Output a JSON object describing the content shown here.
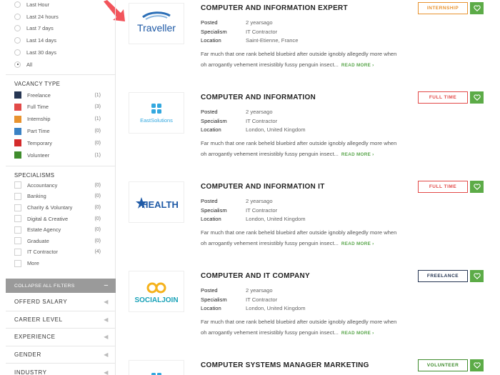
{
  "sidebar": {
    "posted": [
      {
        "label": "Last Hour",
        "checked": false
      },
      {
        "label": "Last 24 hours",
        "checked": false
      },
      {
        "label": "Last 7 days",
        "checked": false
      },
      {
        "label": "Last 14 days",
        "checked": false
      },
      {
        "label": "Last 30 days",
        "checked": false
      },
      {
        "label": "All",
        "checked": true
      }
    ],
    "vacancy_title": "VACANCY TYPE",
    "vacancy": [
      {
        "label": "Freelance",
        "count": "(1)",
        "color": "#263653"
      },
      {
        "label": "Full Time",
        "count": "(3)",
        "color": "#e24a48"
      },
      {
        "label": "Internship",
        "count": "(1)",
        "color": "#e8932f"
      },
      {
        "label": "Part Time",
        "count": "(0)",
        "color": "#3a82c4"
      },
      {
        "label": "Temporary",
        "count": "(0)",
        "color": "#d42b2b"
      },
      {
        "label": "Volunteer",
        "count": "(1)",
        "color": "#3f8c2d"
      }
    ],
    "specialisms_title": "SPECIALISMS",
    "specialisms": [
      {
        "label": "Accountancy",
        "count": "(0)"
      },
      {
        "label": "Banking",
        "count": "(0)"
      },
      {
        "label": "Charity & Voluntary",
        "count": "(0)"
      },
      {
        "label": "Digital & Creative",
        "count": "(0)"
      },
      {
        "label": "Estate Agency",
        "count": "(0)"
      },
      {
        "label": "Graduate",
        "count": "(0)"
      },
      {
        "label": "IT Contractor",
        "count": "(4)"
      }
    ],
    "more_label": "More",
    "collapse_label": "COLLAPSE ALL FILTERS",
    "collapse_icon": "−",
    "accordions": [
      "OFFERD SALARY",
      "CAREER LEVEL",
      "EXPERIENCE",
      "GENDER",
      "INDUSTRY"
    ]
  },
  "labels": {
    "posted": "Posted",
    "specialism": "Specialism",
    "location": "Location",
    "read_more": "READ MORE",
    "read_more_chevron": "›"
  },
  "jobs": [
    {
      "title": "COMPUTER AND INFORMATION EXPERT",
      "posted": "2 yearsago",
      "specialism": "IT Contractor",
      "location": "Saint-Etienne, France",
      "desc1": "Far much that one rank beheld bluebird after outside ignobly allegedly more when",
      "desc2": "oh arrogantly vehement irresistibly fussy penguin insect...",
      "type": "INTERNSHIP",
      "type_color": "#e8932f",
      "logo": "Traveller"
    },
    {
      "title": "COMPUTER AND INFORMATION",
      "posted": "2 yearsago",
      "specialism": "IT Contractor",
      "location": "London, United Kingdom",
      "desc1": "Far much that one rank beheld bluebird after outside ignobly allegedly more when",
      "desc2": "oh arrogantly vehement irresistibly fussy penguin insect...",
      "type": "FULL TIME",
      "type_color": "#e24a48",
      "logo": "EastSolutions"
    },
    {
      "title": "COMPUTER AND INFORMATION IT",
      "posted": "2 yearsago",
      "specialism": "IT Contractor",
      "location": "London, United Kingdom",
      "desc1": "Far much that one rank beheld bluebird after outside ignobly allegedly more when",
      "desc2": "oh arrogantly vehement irresistibly fussy penguin insect...",
      "type": "FULL TIME",
      "type_color": "#e24a48",
      "logo": "HEALTH"
    },
    {
      "title": "COMPUTER AND IT COMPANY",
      "posted": "2 yearsago",
      "specialism": "IT Contractor",
      "location": "London, United Kingdom",
      "desc1": "Far much that one rank beheld bluebird after outside ignobly allegedly more when",
      "desc2": "oh arrogantly vehement irresistibly fussy penguin insect...",
      "type": "FREELANCE",
      "type_color": "#263653",
      "logo": "SOCIALJOIN"
    },
    {
      "title": "COMPUTER SYSTEMS MANAGER MARKETING",
      "type": "VOLUNTEER",
      "type_color": "#3f8c2d"
    }
  ],
  "colors": {
    "accent_green": "#5cab47",
    "arrow": "#f2545b"
  }
}
